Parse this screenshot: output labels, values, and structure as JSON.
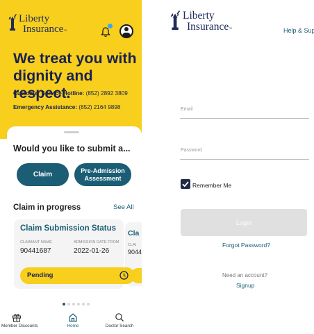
{
  "colors": {
    "brand_yellow": "#f7cf1c",
    "brand_navy": "#1a2250",
    "teal": "#1a5d74"
  },
  "home": {
    "logo": {
      "line1": "Liberty",
      "line2": "Insurance",
      "tm": "™"
    },
    "header_icons": [
      "bell-icon",
      "avatar-icon"
    ],
    "headline": "We treat you with dignity and respect.",
    "hotline": {
      "label": "Customer Service Hotline:",
      "value": "(852) 2892 3809"
    },
    "emergency": {
      "label": "Emergency Assistance:",
      "value": "(852) 2164 9898"
    },
    "submit_question": "Would you like to submit a...",
    "buttons": {
      "claim": "Claim",
      "pre_admission": "Pre-Admission Assessment"
    },
    "claim_in_progress": "Claim in progress",
    "see_all": "See All",
    "card": {
      "title": "Claim Submission Status",
      "claimant_label": "CLAIMANT NAME",
      "claimant_value": "90441687",
      "date_label": "ADMISSION DATE FROM",
      "date_value": "2022-01-26",
      "status": "Pending"
    },
    "card2": {
      "title": "Cla",
      "label": "CLAI",
      "value": "9044"
    },
    "pager": {
      "total": 6,
      "active": 1
    },
    "tabs": [
      {
        "label": "Member Discounts",
        "icon": "gift-icon"
      },
      {
        "label": "Home",
        "icon": "home-icon"
      },
      {
        "label": "Doctor Search",
        "icon": "search-icon"
      }
    ]
  },
  "login": {
    "logo": {
      "line1": "Liberty",
      "line2": "Insurance",
      "tm": "™"
    },
    "help": "Help & Supp",
    "email_placeholder": "Email",
    "password_placeholder": "Password",
    "remember_me": "Remember Me",
    "remember_checked": true,
    "login_button": "Login",
    "forgot_password": "Forgot Password?",
    "need_account": "Need an account?",
    "signup": "Signup"
  }
}
